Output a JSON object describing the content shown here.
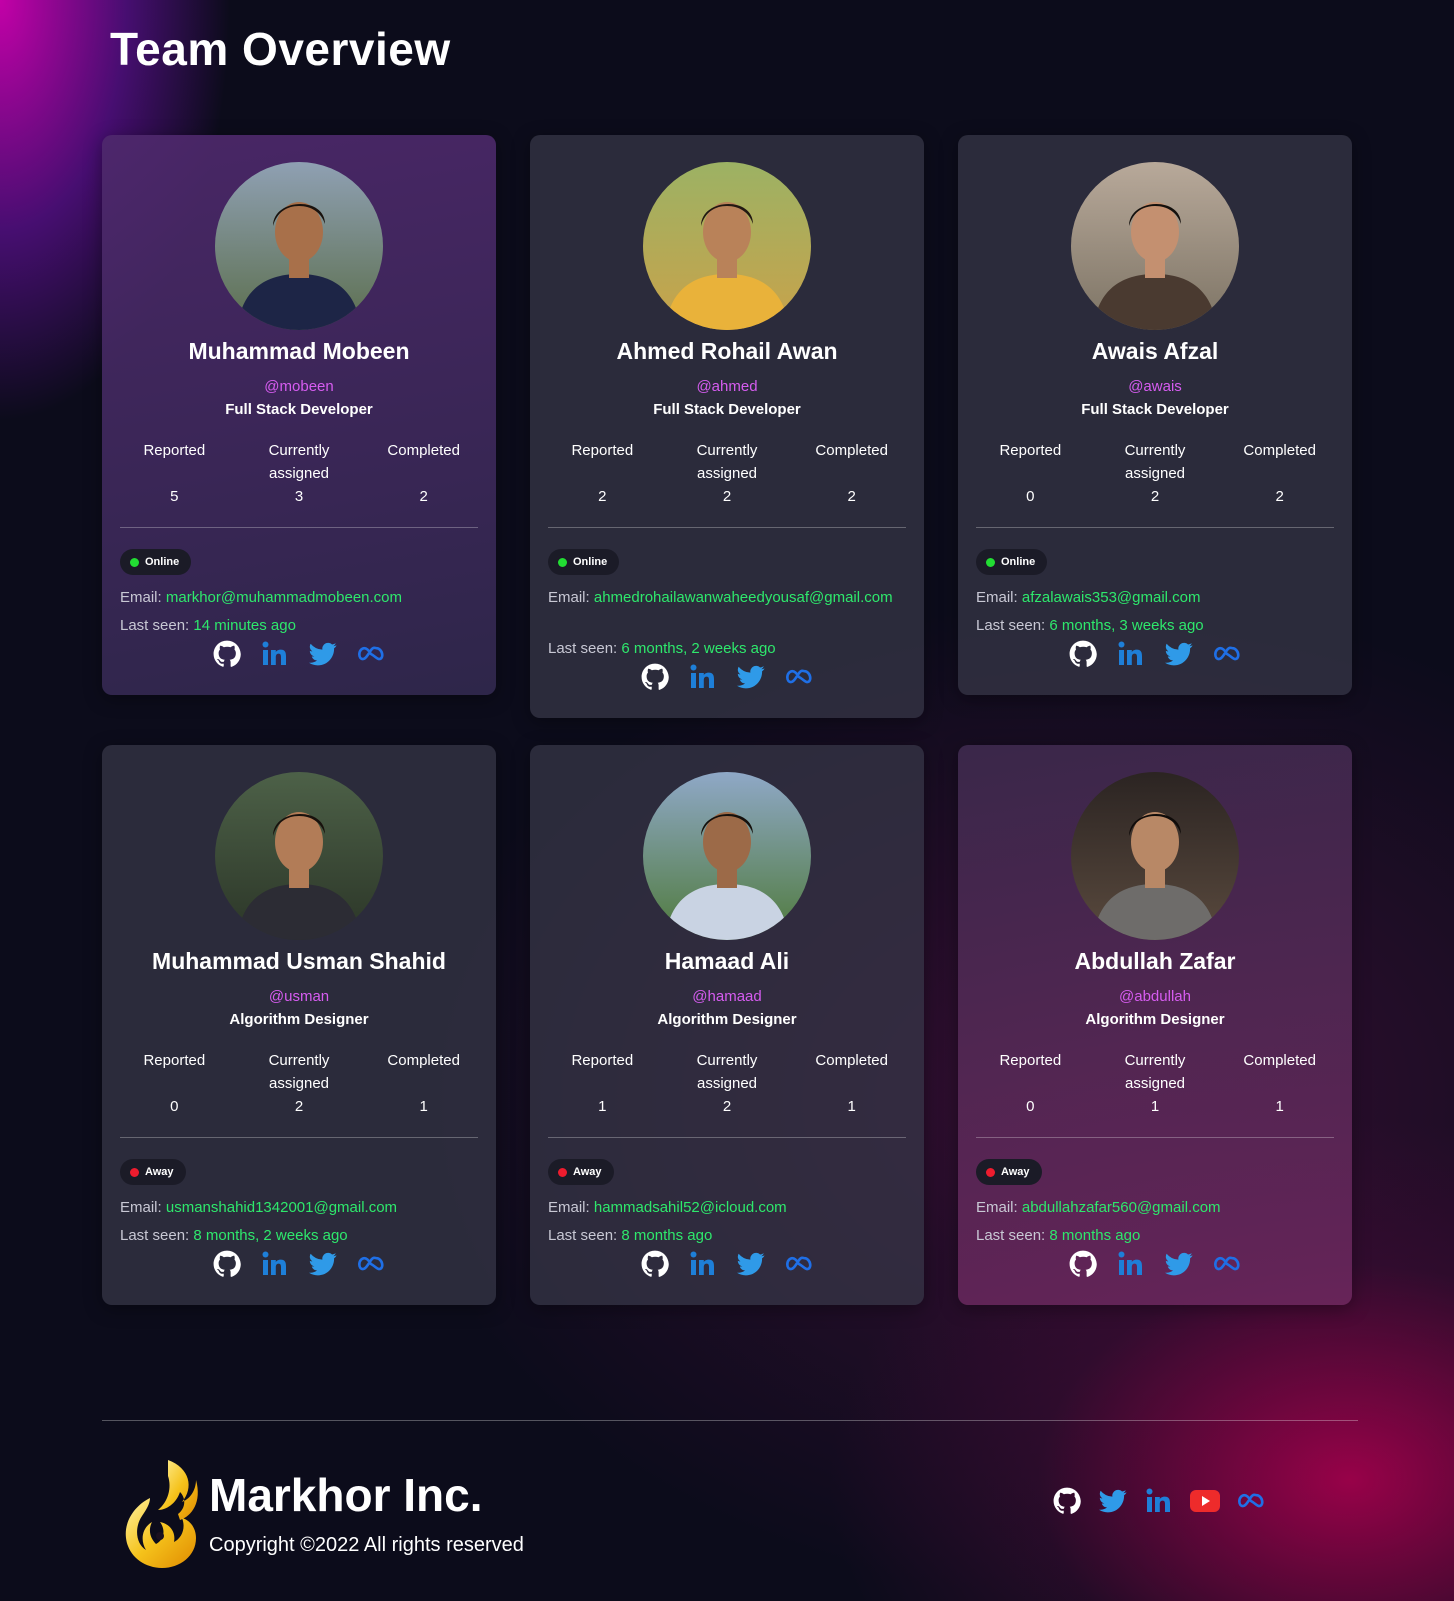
{
  "page": {
    "title": "Team Overview"
  },
  "colors": {
    "handle": "#d65cf0",
    "link": "#2ee86c",
    "online": "#22dd33",
    "away": "#ee1c2e"
  },
  "stat_labels": {
    "reported": "Reported",
    "assigned": "Currently assigned",
    "completed": "Completed"
  },
  "members": [
    {
      "name": "Muhammad Mobeen",
      "handle": "@mobeen",
      "role": "Full Stack Developer",
      "reported": "5",
      "assigned": "3",
      "completed": "2",
      "status": "Online",
      "email_label": "Email:",
      "email": "markhor@muhammadmobeen.com",
      "last_seen_label": "Last seen:",
      "last_seen": "14 minutes ago"
    },
    {
      "name": "Ahmed Rohail Awan",
      "handle": "@ahmed",
      "role": "Full Stack Developer",
      "reported": "2",
      "assigned": "2",
      "completed": "2",
      "status": "Online",
      "email_label": "Email:",
      "email": "ahmedrohailawanwaheedyousaf@gmail.com",
      "last_seen_label": "Last seen:",
      "last_seen": "6 months, 2 weeks ago"
    },
    {
      "name": "Awais Afzal",
      "handle": "@awais",
      "role": "Full Stack Developer",
      "reported": "0",
      "assigned": "2",
      "completed": "2",
      "status": "Online",
      "email_label": "Email:",
      "email": "afzalawais353@gmail.com",
      "last_seen_label": "Last seen:",
      "last_seen": "6 months, 3 weeks ago"
    },
    {
      "name": "Muhammad Usman Shahid",
      "handle": "@usman",
      "role": "Algorithm Designer",
      "reported": "0",
      "assigned": "2",
      "completed": "1",
      "status": "Away",
      "email_label": "Email:",
      "email": "usmanshahid1342001@gmail.com",
      "last_seen_label": "Last seen:",
      "last_seen": "8 months, 2 weeks ago"
    },
    {
      "name": "Hamaad Ali",
      "handle": "@hamaad",
      "role": "Algorithm Designer",
      "reported": "1",
      "assigned": "2",
      "completed": "1",
      "status": "Away",
      "email_label": "Email:",
      "email": "hammadsahil52@icloud.com",
      "last_seen_label": "Last seen:",
      "last_seen": "8 months ago"
    },
    {
      "name": "Abdullah Zafar",
      "handle": "@abdullah",
      "role": "Algorithm Designer",
      "reported": "0",
      "assigned": "1",
      "completed": "1",
      "status": "Away",
      "email_label": "Email:",
      "email": "abdullahzafar560@gmail.com",
      "last_seen_label": "Last seen:",
      "last_seen": "8 months ago"
    }
  ],
  "card_socials": [
    "github-icon",
    "linkedin-icon",
    "twitter-icon",
    "meta-icon"
  ],
  "footer": {
    "brand": "Markhor Inc.",
    "copyright": "Copyright ©2022 All rights reserved",
    "socials": [
      "github-icon",
      "twitter-icon",
      "linkedin-icon",
      "youtube-icon",
      "meta-icon"
    ]
  }
}
